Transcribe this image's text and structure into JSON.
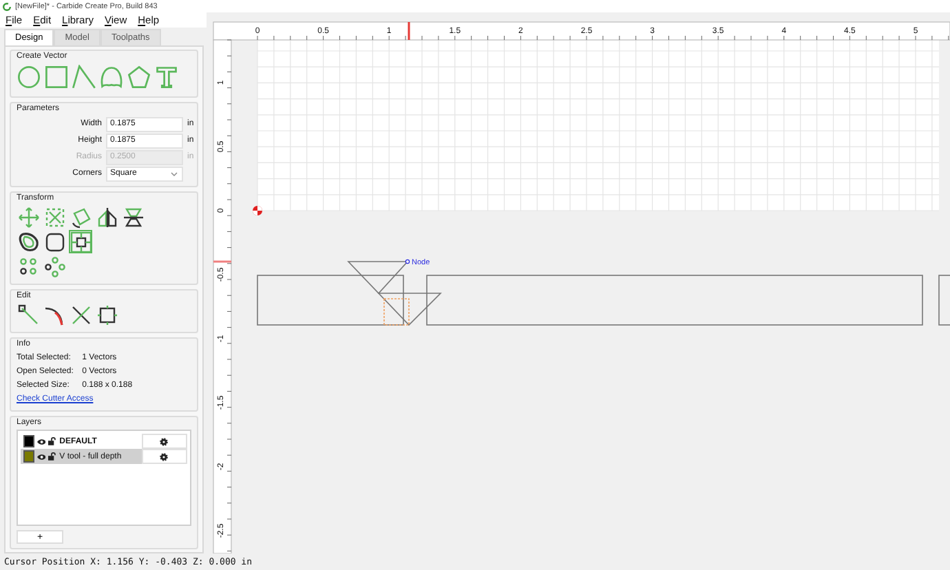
{
  "window": {
    "title": "[NewFile]* - Carbide Create Pro, Build 843"
  },
  "menu": [
    "File",
    "Edit",
    "Library",
    "View",
    "Help"
  ],
  "tabs": [
    {
      "label": "Design",
      "selected": true
    },
    {
      "label": "Model",
      "selected": false
    },
    {
      "label": "Toolpaths",
      "selected": false
    }
  ],
  "create_vector": {
    "title": "Create Vector"
  },
  "parameters": {
    "title": "Parameters",
    "fields": [
      {
        "label": "Width",
        "value": "0.1875",
        "unit": "in",
        "kind": "text",
        "disabled": false
      },
      {
        "label": "Height",
        "value": "0.1875",
        "unit": "in",
        "kind": "text",
        "disabled": false
      },
      {
        "label": "Radius",
        "value": "0.2500",
        "unit": "in",
        "kind": "text",
        "disabled": true
      },
      {
        "label": "Corners",
        "value": "Square",
        "kind": "dropdown"
      }
    ]
  },
  "transform": {
    "title": "Transform"
  },
  "edit": {
    "title": "Edit"
  },
  "info": {
    "title": "Info",
    "rows": [
      {
        "label": "Total Selected:",
        "value": "1 Vectors"
      },
      {
        "label": "Open Selected:",
        "value": "0 Vectors"
      },
      {
        "label": "Selected Size:",
        "value": "0.188 x 0.188"
      }
    ],
    "link": "Check Cutter Access"
  },
  "layers": {
    "title": "Layers",
    "items": [
      {
        "name": "DEFAULT",
        "color": "#000000",
        "active": true,
        "selected": false
      },
      {
        "name": "V tool - full depth",
        "color": "#7a7a00",
        "active": false,
        "selected": true
      }
    ],
    "add_button": "+"
  },
  "canvas": {
    "x_labels": [
      "0",
      "0.5",
      "1",
      "1.5",
      "2",
      "2.5",
      "3",
      "3.5",
      "4",
      "4.5",
      "5"
    ],
    "y_labels": [
      "1",
      "0.5",
      "0",
      "-0.5",
      "-1",
      "-1.5",
      "-2",
      "-2.5"
    ],
    "node_label": "Node"
  },
  "status_bar": "Cursor Position X: 1.156 Y: -0.403 Z: 0.000 in"
}
